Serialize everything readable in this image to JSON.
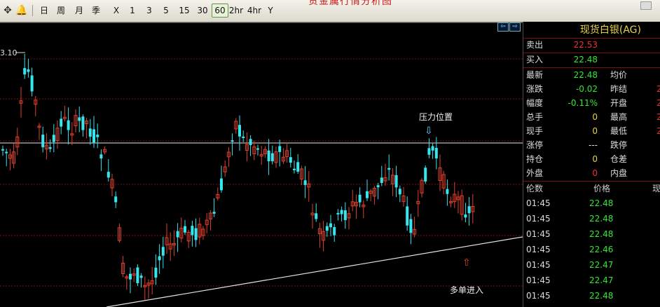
{
  "toolbar": {
    "icons": [
      "pan-icon",
      "alarm-bell-icon"
    ],
    "periods": [
      "日",
      "周",
      "月",
      "季",
      "X",
      "1",
      "3",
      "5",
      "15",
      "30",
      "60",
      "2hr",
      "4hr",
      "Y"
    ],
    "active_period": "60",
    "title_fragment": "贵金属行情分析图"
  },
  "chart": {
    "top_price_label": "3.10",
    "annotations": {
      "pressure": "压力位置",
      "entry": "多单进入"
    },
    "colors": {
      "up": "#e0402c",
      "down": "#35e6ef",
      "resistance": "#e6e6e6",
      "trendline": "#e6e6e6",
      "grid": "#7a1010"
    }
  },
  "panel": {
    "title": "现货白银(AG)",
    "sell": {
      "label": "卖出",
      "value": "22.53"
    },
    "buy": {
      "label": "买入",
      "value": "22.48"
    },
    "rows": [
      {
        "label": "最新",
        "value": "22.48",
        "value_color": "green",
        "label2": "均价",
        "value2": ""
      },
      {
        "label": "涨跌",
        "value": "-0.02",
        "value_color": "green",
        "label2": "昨结",
        "value2": "2"
      },
      {
        "label": "幅度",
        "value": "-0.11%",
        "value_color": "green",
        "label2": "开盘",
        "value2": "2"
      },
      {
        "label": "总手",
        "value": "0",
        "value_color": "yellow",
        "label2": "最高",
        "value2": "2"
      },
      {
        "label": "现手",
        "value": "0",
        "value_color": "yellow",
        "label2": "最低",
        "value2": "2"
      },
      {
        "label": "涨停",
        "value": "---",
        "value_color": "white",
        "label2": "跌停",
        "value2": ""
      },
      {
        "label": "持仓",
        "value": "0",
        "value_color": "yellow",
        "label2": "仓差",
        "value2": ""
      },
      {
        "label": "外盘",
        "value": "0",
        "value_color": "red",
        "label2": "内盘",
        "value2": ""
      }
    ],
    "ticks_header": {
      "time": "伦数",
      "price": "价格",
      "vol": "现"
    },
    "ticks": [
      {
        "time": "01:45",
        "price": "22.48"
      },
      {
        "time": "01:45",
        "price": "22.48"
      },
      {
        "time": "01:45",
        "price": "22.48"
      },
      {
        "time": "01:45",
        "price": "22.46"
      },
      {
        "time": "01:45",
        "price": "22.47"
      },
      {
        "time": "01:45",
        "price": "22.47"
      },
      {
        "time": "01:45",
        "price": "22.48"
      }
    ]
  }
}
